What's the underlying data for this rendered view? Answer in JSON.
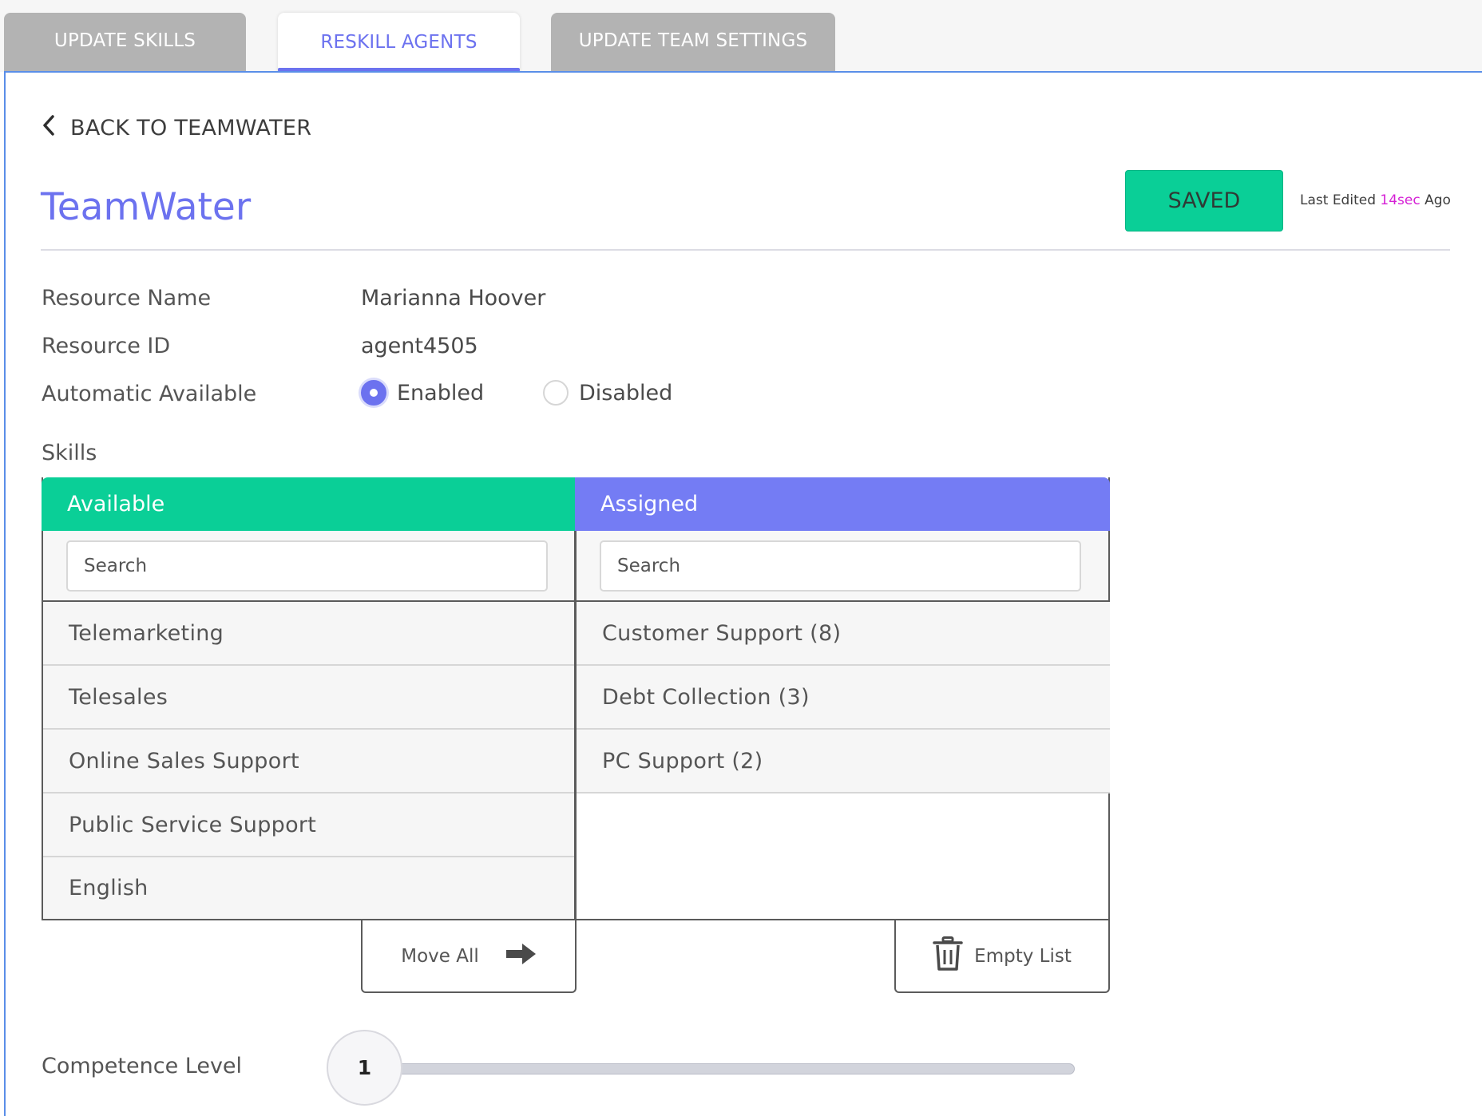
{
  "tabs": [
    {
      "label": "UPDATE SKILLS"
    },
    {
      "label": "RESKILL AGENTS"
    },
    {
      "label": "UPDATE TEAM SETTINGS"
    }
  ],
  "back_link": "BACK TO TEAMWATER",
  "team_title": "TeamWater",
  "save_status": "SAVED",
  "last_edited": {
    "prefix": "Last Edited",
    "value": "14sec",
    "suffix": "Ago"
  },
  "fields": {
    "resource_name": {
      "label": "Resource Name",
      "value": "Marianna Hoover"
    },
    "resource_id": {
      "label": "Resource ID",
      "value": "agent4505"
    },
    "automatic_available": {
      "label": "Automatic Available",
      "options": [
        "Enabled",
        "Disabled"
      ],
      "selected": "Enabled"
    }
  },
  "skills": {
    "label": "Skills",
    "available": {
      "title": "Available",
      "search_placeholder": "Search",
      "items": [
        "Telemarketing",
        "Telesales",
        "Online Sales Support",
        "Public Service Support",
        "English"
      ]
    },
    "assigned": {
      "title": "Assigned",
      "search_placeholder": "Search",
      "items": [
        "Customer Support (8)",
        "Debt Collection (3)",
        "PC Support (2)"
      ]
    },
    "move_all_label": "Move All",
    "empty_list_label": "Empty List"
  },
  "competence": {
    "label": "Competence Level",
    "value": "1"
  },
  "colors": {
    "accent": "#6c72ef",
    "available_header": "#0acf97",
    "assigned_header": "#747cf4",
    "saved": "#0acf97",
    "highlight": "#d51fd5"
  }
}
